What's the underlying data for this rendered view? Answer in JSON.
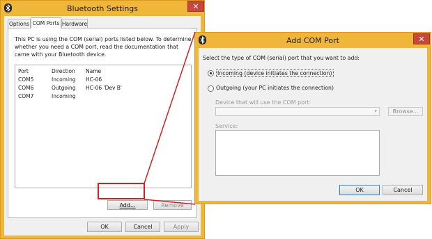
{
  "bt_settings": {
    "title": "Bluetooth Settings",
    "close_glyph": "✕",
    "tabs": [
      {
        "label": "Options"
      },
      {
        "label": "COM Ports"
      },
      {
        "label": "Hardware"
      }
    ],
    "description": "This PC is using the COM (serial) ports listed below. To determine whether you need a COM port, read the documentation that came with your Bluetooth device.",
    "columns": [
      "Port",
      "Direction",
      "Name"
    ],
    "rows": [
      {
        "port": "COM5",
        "direction": "Incoming",
        "name": "HC-06"
      },
      {
        "port": "COM6",
        "direction": "Outgoing",
        "name": "HC-06 'Dev B'"
      },
      {
        "port": "COM7",
        "direction": "Incoming",
        "name": ""
      }
    ],
    "add_label": "Add...",
    "remove_label": "Remove",
    "ok_label": "OK",
    "cancel_label": "Cancel",
    "apply_label": "Apply"
  },
  "add_com": {
    "title": "Add COM Port",
    "close_glyph": "✕",
    "prompt": "Select the type of COM (serial) port that you want to add:",
    "incoming_label": "Incoming (device initiates the connection)",
    "outgoing_label": "Outgoing (your PC initiates the connection)",
    "device_label": "Device that will use the COM port:",
    "browse_label": "Browse...",
    "service_label": "Service:",
    "ok_label": "OK",
    "cancel_label": "Cancel"
  },
  "colors": {
    "frame": "#f0b63a",
    "close": "#c7483a",
    "callout": "#d02020"
  },
  "icons": [
    "bluetooth-icon",
    "close-icon",
    "chevron-down-icon"
  ]
}
